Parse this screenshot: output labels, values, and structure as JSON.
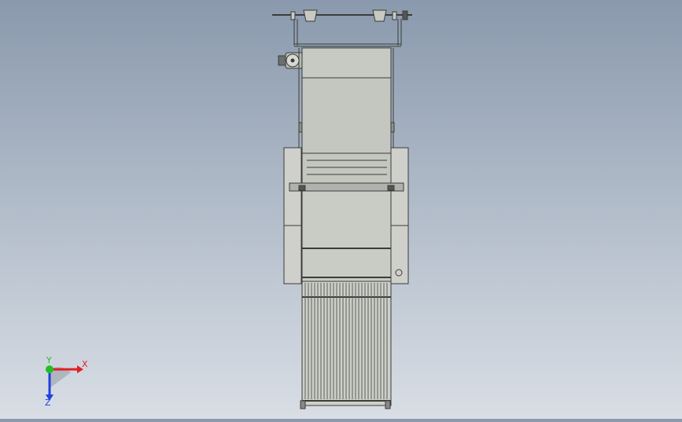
{
  "viewport": {
    "background_top": "#8a99ad",
    "background_bottom": "#d9dee5",
    "model": {
      "panel_fill": "#c7c9c3",
      "side_panel_fill": "#cfd0cb",
      "line_color": "#3a3d3a",
      "bar_color": "#5a5f5a"
    }
  },
  "triad": {
    "x_label": "X",
    "y_label": "Y",
    "z_label": "Z",
    "x_color": "#e02020",
    "y_color": "#20c020",
    "z_color": "#2040e0"
  }
}
